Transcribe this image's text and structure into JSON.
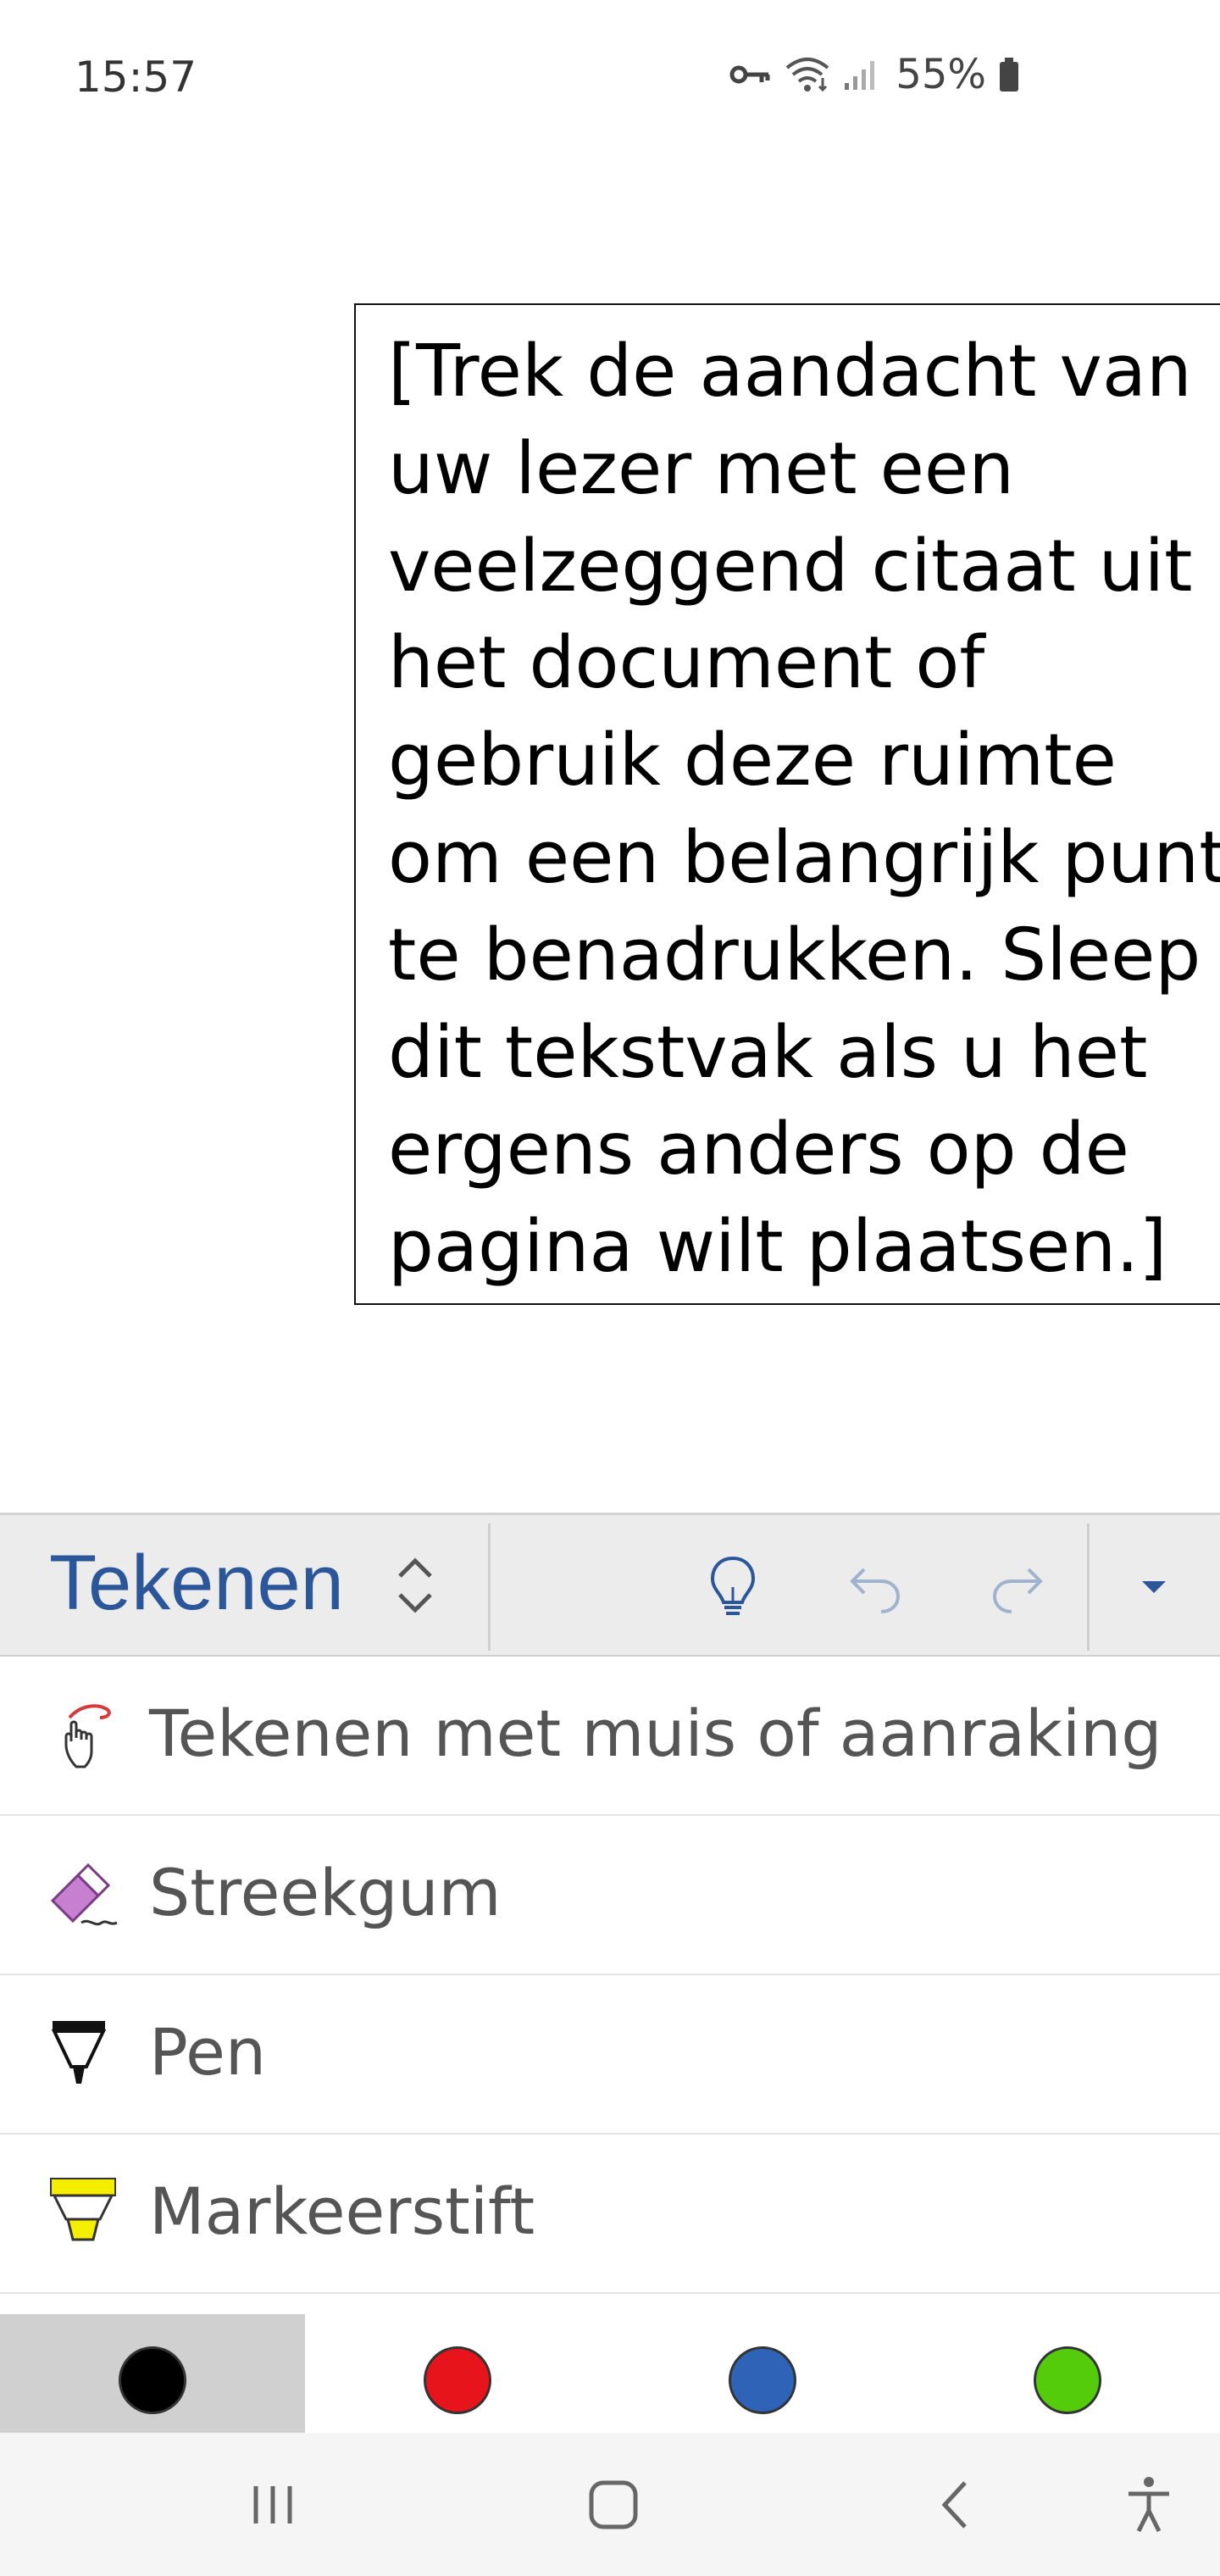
{
  "status": {
    "time": "15:57",
    "battery": "55%",
    "icons": [
      "key-icon",
      "wifi-icon",
      "signal-icon",
      "battery-icon"
    ]
  },
  "document": {
    "pull_quote": "[Trek de aandacht van\nuw lezer met een\nveelzeggend citaat uit\nhet document of\ngebruik deze ruimte\nom een belangrijk punt\nte benadrukken. Sleep\ndit tekstvak als u het\nergens anders op de\npagina wilt plaatsen.]"
  },
  "toolbar": {
    "tab_title": "Tekenen",
    "icons": [
      "tab-switch-icon",
      "lightbulb-icon",
      "undo-icon",
      "redo-icon",
      "expand-icon"
    ]
  },
  "menu": {
    "items": [
      {
        "label": "Tekenen met muis of aanraking",
        "icon": "draw-touch-icon"
      },
      {
        "label": "Streekgum",
        "icon": "eraser-icon"
      },
      {
        "label": "Pen",
        "icon": "pen-icon"
      },
      {
        "label": "Markeerstift",
        "icon": "highlighter-icon"
      }
    ]
  },
  "palette": {
    "colors": [
      {
        "name": "black",
        "hex": "#000000",
        "selected": true
      },
      {
        "name": "red",
        "hex": "#e8141c",
        "selected": false
      },
      {
        "name": "blue",
        "hex": "#2f63b7",
        "selected": false
      },
      {
        "name": "green",
        "hex": "#54cc0c",
        "selected": false
      }
    ]
  },
  "navbar": {
    "icons": [
      "recent-apps-icon",
      "home-icon",
      "back-icon",
      "accessibility-icon"
    ]
  }
}
